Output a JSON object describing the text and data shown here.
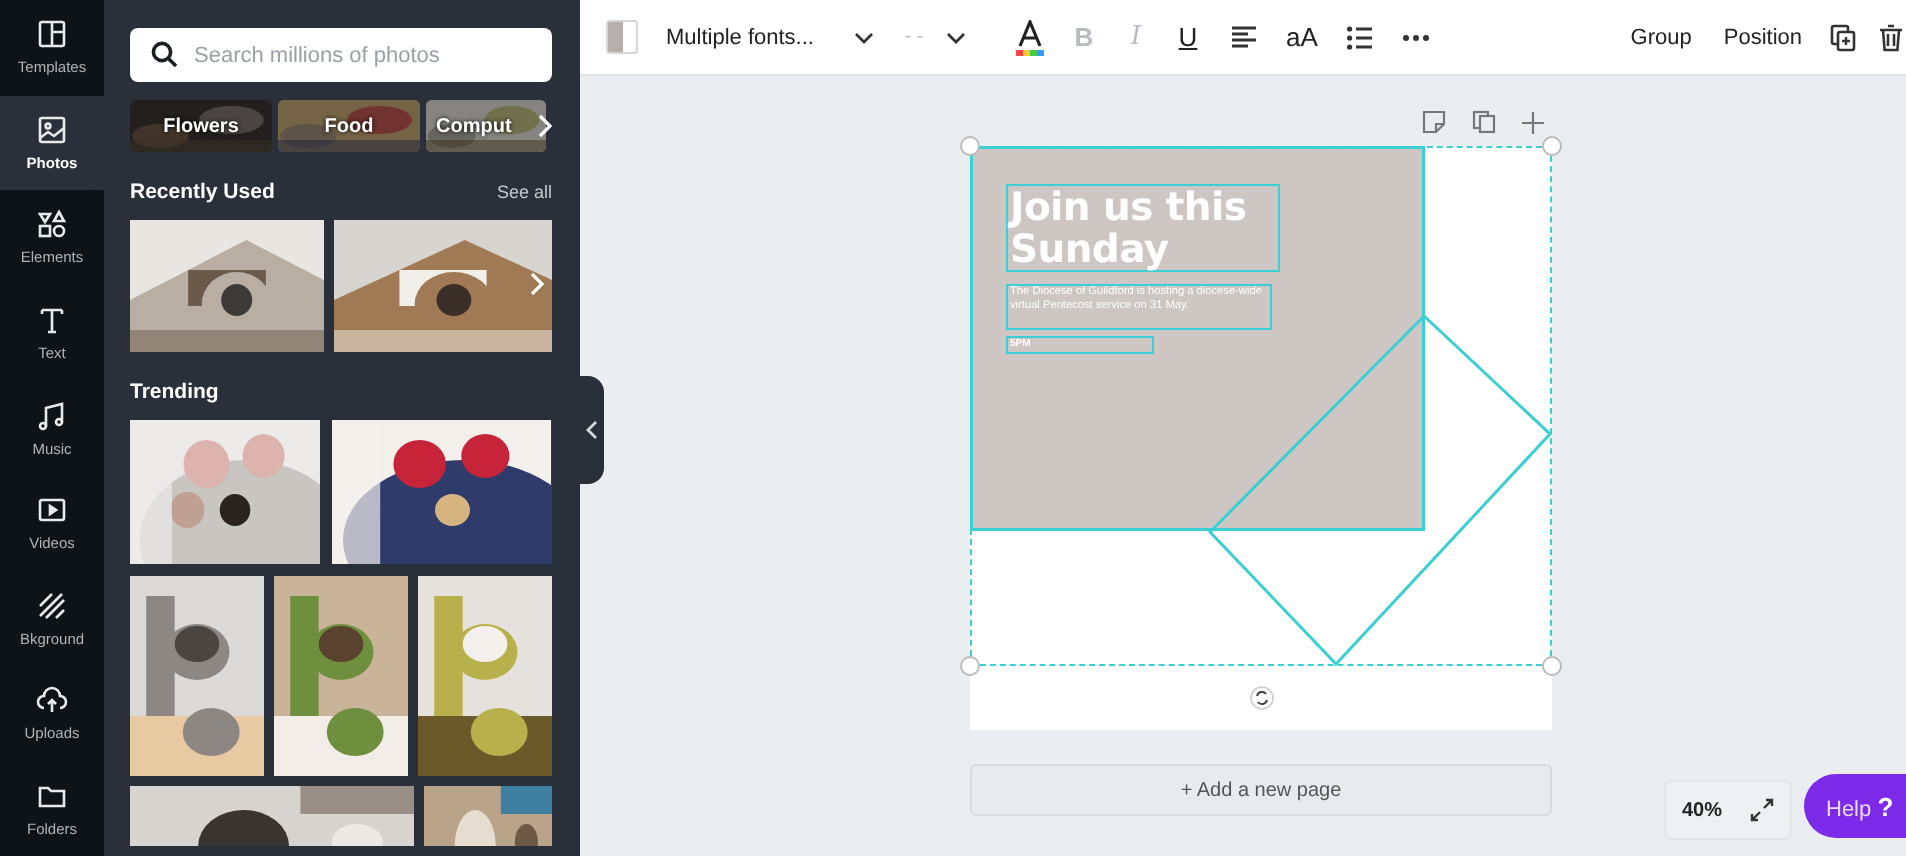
{
  "sidebar": {
    "items": [
      {
        "label": "Templates",
        "selected": false
      },
      {
        "label": "Photos",
        "selected": true
      },
      {
        "label": "Elements",
        "selected": false
      },
      {
        "label": "Text",
        "selected": false
      },
      {
        "label": "Music",
        "selected": false
      },
      {
        "label": "Videos",
        "selected": false
      },
      {
        "label": "Bkground",
        "selected": false
      },
      {
        "label": "Uploads",
        "selected": false
      },
      {
        "label": "Folders",
        "selected": false
      }
    ]
  },
  "panel": {
    "search": {
      "placeholder": "Search millions of photos"
    },
    "categories": [
      "Flowers",
      "Food",
      "Comput"
    ],
    "recently_used": {
      "title": "Recently Used",
      "link": "See all"
    },
    "trending": {
      "title": "Trending"
    }
  },
  "toolbar": {
    "font": "Multiple fonts...",
    "font_size": "- -",
    "format": [
      {
        "label": "B",
        "disabled": true
      },
      {
        "label": "I",
        "disabled": true
      },
      {
        "label": "U",
        "disabled": false
      }
    ],
    "case": "aA",
    "group": "Group",
    "position": "Position"
  },
  "design": {
    "title": "Join us this Sunday",
    "body": "The Diocese of Guildford is hosting a diocese-wide virtual Pentecost service on 31 May.",
    "time": "5PM"
  },
  "add_page": "+ Add a new page",
  "zoom": "40%",
  "help": "Help **?**"
}
